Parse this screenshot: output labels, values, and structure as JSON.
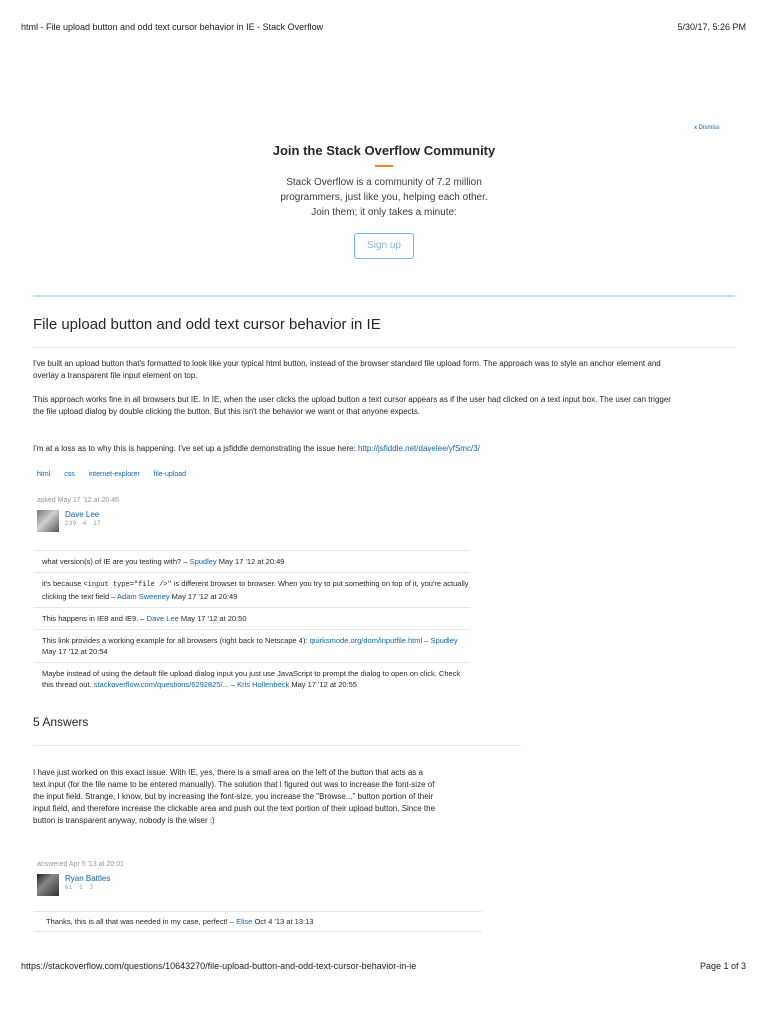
{
  "print": {
    "title": "html - File upload button and odd text cursor behavior in IE - Stack Overflow",
    "date": "5/30/17, 5:26 PM",
    "url": "https://stackoverflow.com/questions/10643270/file-upload-button-and-odd-text-cursor-behavior-in-ie",
    "page": "Page 1 of 3"
  },
  "banner": {
    "dismiss": "x Dismiss",
    "title": "Join the Stack Overflow Community",
    "line1": "Stack Overflow is a community of 7.2 million",
    "line2": "programmers, just like you, helping each other.",
    "line3": "Join them; it only takes a minute:",
    "signup": "Sign up",
    "accent": "#f48024"
  },
  "question": {
    "title": "File upload button and odd text cursor behavior in IE",
    "p1": "I've built an upload button that's formatted to look like your typical html button, instead of the browser standard file upload form. The approach was to style an anchor element and overlay a transparent file input element on top.",
    "p2": "This approach works fine in all browsers but IE. In IE, when the user clicks the upload button a text cursor appears as if the user had clicked on a text input box. The user can trigger the file upload dialog by double clicking the button. But this isn't the behavior we want or that anyone expects.",
    "p3_text": "I'm at a loss as to why this is happening. I've set up a jsfiddle demonstrating the issue here: ",
    "p3_link": "http://jsfiddle.net/davelee/yfSmc/3/",
    "tags": [
      "html",
      "css",
      "internet-explorer",
      "file-upload"
    ],
    "asked": "asked May 17 '12 at 20:46",
    "user": {
      "name": "Dave Lee",
      "rep": "239",
      "silver": "4",
      "bronze": "17"
    }
  },
  "comments": [
    {
      "text": "what version(s) of IE are you testing with? – ",
      "user": "Spudley",
      "date": " May 17 '12 at 20:49"
    },
    {
      "pre": "it's because ",
      "code": "<input type=\"file />\"",
      "post": " is different browser to browser. When you try to put something on top of it, you're actually clicking the text field – ",
      "user": "Adam Sweeney",
      "date": " May 17 '12 at 20:49"
    },
    {
      "text": "This happens in IE8 and IE9. – ",
      "user": "Dave Lee",
      "date": " May 17 '12 at 20:50"
    },
    {
      "text": "This link provides a working example for all browsers (right back to Netscape 4): ",
      "link": "quirksmode.org/dom/inputfile.html",
      "sep": " – ",
      "user": "Spudley",
      "date": " May 17 '12 at 20:54"
    },
    {
      "text": "Maybe instead of using the default file upload dialog input you just use JavaScript to prompt the dialog to open on click. Check this thread out. ",
      "link": "stackoverflow.com/questions/6292825/...",
      "sep": " – ",
      "user": "Kris Hollenbeck",
      "date": " May 17 '12 at 20:55"
    }
  ],
  "answers": {
    "title": "5 Answers",
    "first": {
      "text": "I have just worked on this exact issue. With IE, yes, there is a small area on the left of the button that acts as a text input (for the file name to be entered manually). The solution that I figured out was to increase the font-size of the input field. Strange, I know, but by increasing the font-size, you increase the \"Browse...\" button portion of their input field, and therefore increase the clickable area and push out the text portion of their upload button. Since the button is transparent anyway, nobody is the wiser :)",
      "answered": "answered Apr 5 '13 at 20:01",
      "user": {
        "name": "Ryan Battles",
        "rep": "61",
        "silver": "1",
        "bronze": "3"
      },
      "comment": {
        "text": "Thanks, this is all that was needed in my case, perfect! – ",
        "user": "Elise",
        "date": " Oct 4 '13 at 13:13"
      }
    }
  }
}
